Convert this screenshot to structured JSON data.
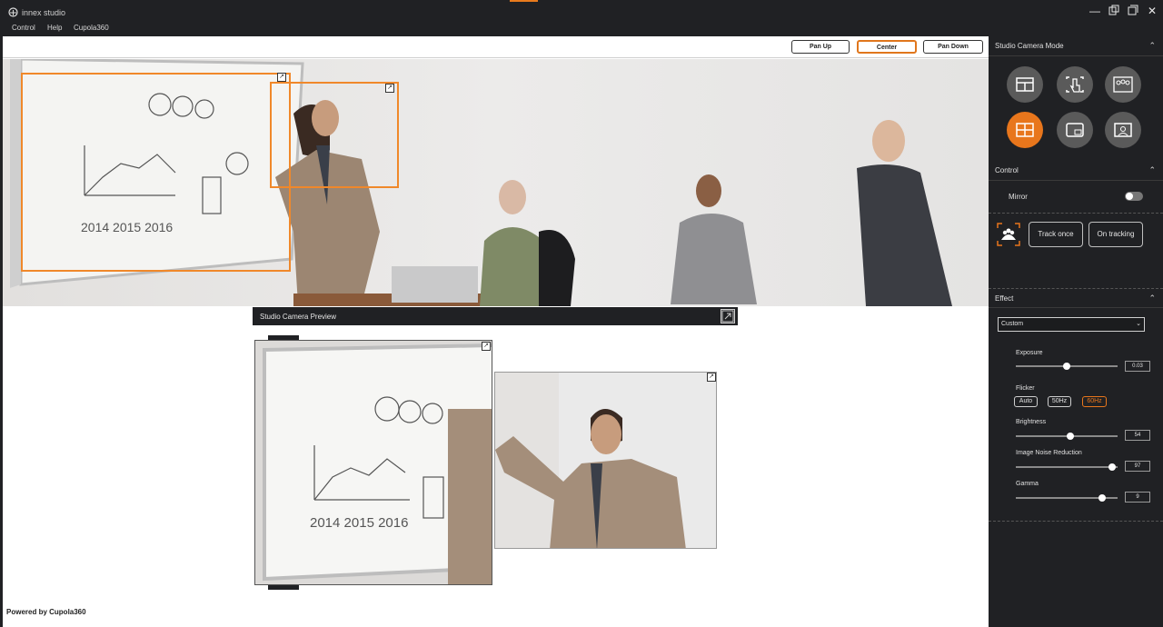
{
  "window": {
    "title": "innex studio"
  },
  "menu": {
    "items": [
      "Control",
      "Help",
      "Cupola360"
    ]
  },
  "toolbar": {
    "buttons": [
      {
        "label": "Pan Up",
        "active": false
      },
      {
        "label": "Center",
        "active": true
      },
      {
        "label": "Pan Down",
        "active": false
      }
    ]
  },
  "preview": {
    "title": "Studio Camera Preview"
  },
  "sidebar": {
    "mode": {
      "title": "Studio Camera Mode"
    },
    "control": {
      "title": "Control",
      "mirror_label": "Mirror",
      "track_once": "Track once",
      "on_tracking": "On tracking"
    },
    "effect": {
      "title": "Effect",
      "preset": "Custom",
      "exposure": {
        "label": "Exposure",
        "value": "0.03",
        "level": 0.5
      },
      "flicker": {
        "label": "Flicker",
        "options": [
          "Auto",
          "50Hz",
          "60Hz"
        ],
        "selected": "60Hz"
      },
      "brightness": {
        "label": "Brightness",
        "value": "54",
        "level": 0.54
      },
      "noise": {
        "label": "Image Noise Reduction",
        "value": "97",
        "level": 0.95
      },
      "gamma": {
        "label": "Gamma",
        "value": "9",
        "level": 0.85
      }
    }
  },
  "footer": {
    "powered": "Powered by  Cupola360"
  },
  "colors": {
    "accent": "#e8761c",
    "panel": "#202124"
  }
}
